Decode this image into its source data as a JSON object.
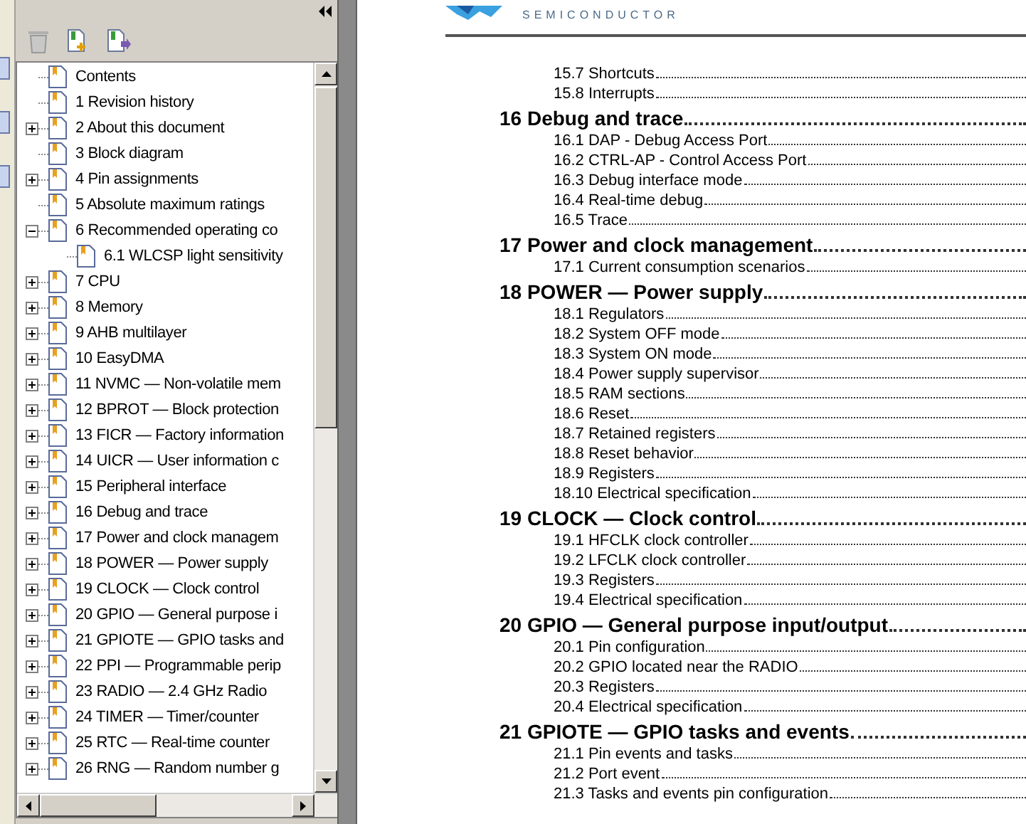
{
  "bookmarks": {
    "items": [
      {
        "label": "Contents"
      },
      {
        "label": "1 Revision history"
      },
      {
        "label": "2 About this document",
        "expanded": false
      },
      {
        "label": "3 Block diagram"
      },
      {
        "label": "4 Pin assignments",
        "expanded": false
      },
      {
        "label": "5 Absolute maximum ratings"
      },
      {
        "label": "6 Recommended operating co",
        "expanded": true,
        "children": [
          {
            "label": "6.1 WLCSP light sensitivity"
          }
        ]
      },
      {
        "label": "7 CPU",
        "expanded": false
      },
      {
        "label": "8 Memory",
        "expanded": false
      },
      {
        "label": "9 AHB multilayer",
        "expanded": false
      },
      {
        "label": "10 EasyDMA",
        "expanded": false
      },
      {
        "label": "11 NVMC — Non-volatile mem",
        "expanded": false
      },
      {
        "label": "12 BPROT — Block protection",
        "expanded": false
      },
      {
        "label": "13 FICR — Factory information",
        "expanded": false
      },
      {
        "label": "14 UICR — User information c",
        "expanded": false
      },
      {
        "label": "15 Peripheral interface",
        "expanded": false
      },
      {
        "label": "16 Debug and trace",
        "expanded": false
      },
      {
        "label": "17 Power and clock managem",
        "expanded": false
      },
      {
        "label": "18 POWER — Power supply",
        "expanded": false
      },
      {
        "label": "19 CLOCK — Clock control",
        "expanded": false
      },
      {
        "label": "20 GPIO — General purpose i",
        "expanded": false
      },
      {
        "label": "21 GPIOTE — GPIO tasks and",
        "expanded": false
      },
      {
        "label": "22 PPI — Programmable perip",
        "expanded": false
      },
      {
        "label": "23 RADIO — 2.4 GHz Radio",
        "expanded": false
      },
      {
        "label": "24 TIMER — Timer/counter",
        "expanded": false
      },
      {
        "label": "25 RTC — Real-time counter",
        "expanded": false
      },
      {
        "label": "26 RNG — Random number g",
        "expanded": false
      }
    ]
  },
  "document": {
    "brand": "SEMICONDUCTOR",
    "toc": [
      {
        "kind": "entry",
        "text": "15.7 Shortcuts"
      },
      {
        "kind": "entry",
        "text": "15.8 Interrupts"
      },
      {
        "kind": "heading",
        "text": "16 Debug and trace"
      },
      {
        "kind": "entry",
        "text": "16.1 DAP - Debug Access Port"
      },
      {
        "kind": "entry",
        "text": "16.2 CTRL-AP - Control Access Port"
      },
      {
        "kind": "entry",
        "text": "16.3 Debug interface mode"
      },
      {
        "kind": "entry",
        "text": "16.4 Real-time debug"
      },
      {
        "kind": "entry",
        "text": "16.5 Trace"
      },
      {
        "kind": "heading",
        "text": "17 Power and clock management"
      },
      {
        "kind": "entry",
        "text": "17.1 Current consumption scenarios"
      },
      {
        "kind": "heading",
        "text": "18 POWER — Power supply"
      },
      {
        "kind": "entry",
        "text": "18.1 Regulators"
      },
      {
        "kind": "entry",
        "text": "18.2 System OFF mode"
      },
      {
        "kind": "entry",
        "text": "18.3 System ON mode"
      },
      {
        "kind": "entry",
        "text": "18.4 Power supply supervisor"
      },
      {
        "kind": "entry",
        "text": "18.5 RAM sections"
      },
      {
        "kind": "entry",
        "text": "18.6 Reset"
      },
      {
        "kind": "entry",
        "text": "18.7 Retained registers"
      },
      {
        "kind": "entry",
        "text": "18.8 Reset behavior"
      },
      {
        "kind": "entry",
        "text": "18.9 Registers"
      },
      {
        "kind": "entry",
        "text": "18.10 Electrical specification"
      },
      {
        "kind": "heading",
        "text": "19 CLOCK — Clock control"
      },
      {
        "kind": "entry",
        "text": "19.1 HFCLK clock controller"
      },
      {
        "kind": "entry",
        "text": "19.2 LFCLK clock controller"
      },
      {
        "kind": "entry",
        "text": "19.3 Registers"
      },
      {
        "kind": "entry",
        "text": "19.4 Electrical specification"
      },
      {
        "kind": "heading",
        "text": "20 GPIO — General purpose input/output"
      },
      {
        "kind": "entry",
        "text": "20.1 Pin configuration"
      },
      {
        "kind": "entry",
        "text": "20.2 GPIO located near the RADIO"
      },
      {
        "kind": "entry",
        "text": "20.3 Registers"
      },
      {
        "kind": "entry",
        "text": "20.4 Electrical specification"
      },
      {
        "kind": "heading",
        "text": "21 GPIOTE — GPIO tasks and events"
      },
      {
        "kind": "entry",
        "text": "21.1 Pin events and tasks"
      },
      {
        "kind": "entry",
        "text": "21.2 Port event"
      },
      {
        "kind": "entry",
        "text": "21.3 Tasks and events pin configuration"
      }
    ]
  }
}
